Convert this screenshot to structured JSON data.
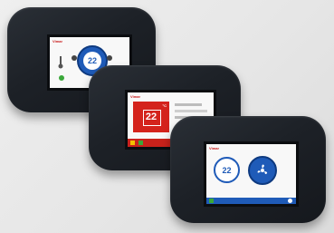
{
  "brand_label": "Vimar",
  "device_left": {
    "temperature_value": "22"
  },
  "device_middle": {
    "temperature_value": "22",
    "temperature_unit": "°C"
  },
  "device_right": {
    "temperature_value": "22"
  },
  "colors": {
    "accent_red": "#d4231c",
    "accent_blue": "#1f5bb8",
    "status_green": "#3aa83a",
    "plate_dark": "#1d2127"
  },
  "icons": [
    "thermometer-icon",
    "fan-icon",
    "power-icon",
    "settings-icon",
    "home-icon"
  ]
}
